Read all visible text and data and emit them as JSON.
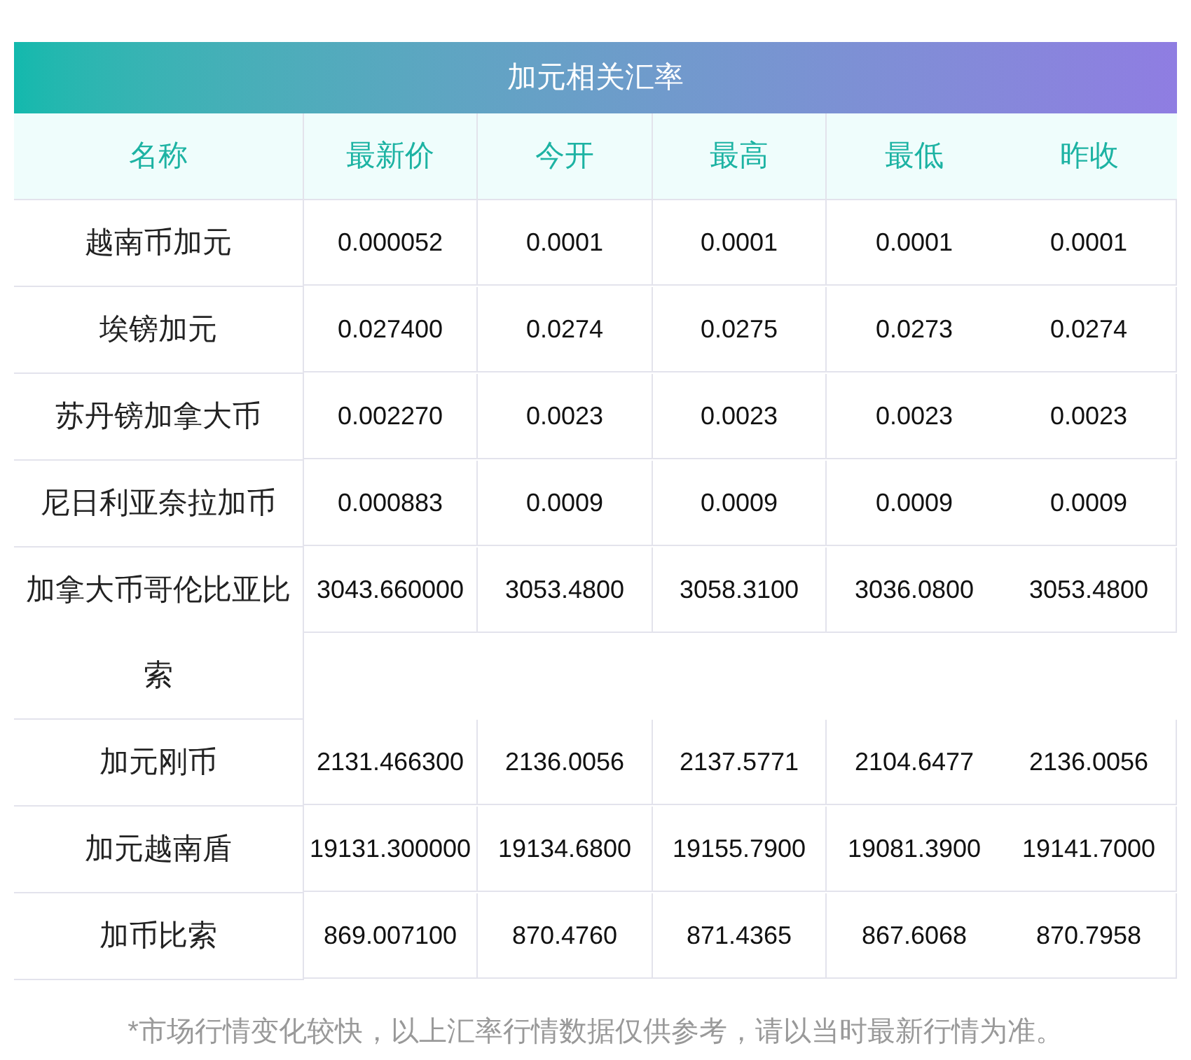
{
  "title": "加元相关汇率",
  "columns": [
    "名称",
    "最新价",
    "今开",
    "最高",
    "最低",
    "昨收"
  ],
  "rows": [
    {
      "name": "越南币加元",
      "values": [
        "0.000052",
        "0.0001",
        "0.0001",
        "0.0001",
        "0.0001"
      ]
    },
    {
      "name": "埃镑加元",
      "values": [
        "0.027400",
        "0.0274",
        "0.0275",
        "0.0273",
        "0.0274"
      ]
    },
    {
      "name": "苏丹镑加拿大币",
      "values": [
        "0.002270",
        "0.0023",
        "0.0023",
        "0.0023",
        "0.0023"
      ]
    },
    {
      "name": "尼日利亚奈拉加币",
      "values": [
        "0.000883",
        "0.0009",
        "0.0009",
        "0.0009",
        "0.0009"
      ]
    },
    {
      "name": "加拿大币哥伦比亚比索",
      "values": [
        "3043.660000",
        "3053.4800",
        "3058.3100",
        "3036.0800",
        "3053.4800"
      ]
    },
    {
      "name": "加元刚币",
      "values": [
        "2131.466300",
        "2136.0056",
        "2137.5771",
        "2104.6477",
        "2136.0056"
      ]
    },
    {
      "name": "加元越南盾",
      "values": [
        "19131.300000",
        "19134.6800",
        "19155.7900",
        "19081.3900",
        "19141.7000"
      ]
    },
    {
      "name": "加币比索",
      "values": [
        "869.007100",
        "870.4760",
        "871.4365",
        "867.6068",
        "870.7958"
      ]
    }
  ],
  "footnote": "*市场行情变化较快，以上汇率行情数据仅供参考，请以当时最新行情为准。"
}
